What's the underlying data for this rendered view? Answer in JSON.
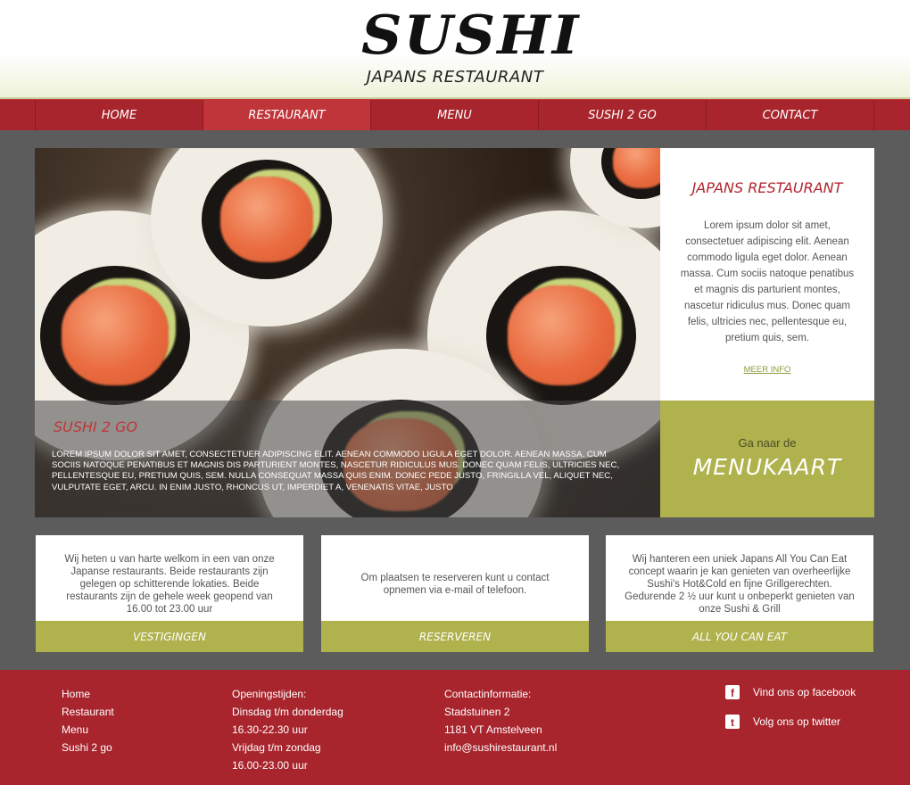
{
  "header": {
    "logo_title": "SUSHI",
    "logo_subtitle": "JAPANS RESTAURANT"
  },
  "nav": {
    "items": [
      {
        "label": "HOME"
      },
      {
        "label": "RESTAURANT",
        "active": true
      },
      {
        "label": "MENU"
      },
      {
        "label": "SUSHI 2 GO"
      },
      {
        "label": "CONTACT"
      }
    ]
  },
  "hero": {
    "caption_title": "SUSHI 2 GO",
    "caption_text": "Lorem ipsum dolor sit amet, consectetuer adipiscing elit. Aenean commodo ligula eget dolor. Aenean massa. Cum sociis natoque penatibus et magnis dis parturient montes, nascetur ridiculus mus. Donec quam felis, ultricies nec, pellentesque eu, pretium quis, sem. Nulla consequat massa quis enim. Donec pede justo, fringilla vel, aliquet nec, vulputate eget, arcu. In enim justo, rhoncus ut, imperdiet a, venenatis vitae, justo"
  },
  "info": {
    "title": "JAPANS RESTAURANT",
    "text": "Lorem ipsum dolor sit amet, consectetuer adipiscing elit. Aenean commodo ligula eget dolor. Aenean massa. Cum sociis natoque penatibus et magnis dis parturient montes, nascetur ridiculus mus. Donec quam felis, ultricies nec, pellentesque eu, pretium quis, sem.",
    "link": "MEER INFO"
  },
  "menu_cta": {
    "sub": "Ga naar de",
    "main": "MENUKAART"
  },
  "cards": [
    {
      "text": "Wij heten u van harte welkom in een van onze Japanse restaurants. Beide restaurants zijn gelegen op schitterende lokaties. Beide restaurants zijn de gehele week geopend van 16.00 tot 23.00 uur",
      "button": "VESTIGINGEN"
    },
    {
      "text": "Om plaatsen te reserveren kunt u contact opnemen via e-mail of telefoon.",
      "button": "RESERVEREN"
    },
    {
      "text": "Wij hanteren een uniek Japans All You Can Eat concept waarin je kan genieten van overheerlijke Sushi's Hot&Cold en fijne Grillgerechten. Gedurende 2 ½ uur kunt u onbeperkt genieten van onze Sushi & Grill",
      "button": "ALL YOU CAN EAT"
    }
  ],
  "footer": {
    "links": [
      "Home",
      "Restaurant",
      "Menu",
      "Sushi 2 go"
    ],
    "hours": [
      "Openingstijden:",
      "Dinsdag t/m donderdag",
      "16.30-22.30 uur",
      "Vrijdag t/m zondag",
      "16.00-23.00 uur"
    ],
    "contact": [
      "Contactinformatie:",
      "Stadstuinen 2",
      "1181 VT Amstelveen",
      "info@sushirestaurant.nl"
    ],
    "facebook": "Vind ons op facebook",
    "twitter": "Volg ons op twitter"
  },
  "colors": {
    "brand_red": "#a8252d",
    "accent_olive": "#b0b24e",
    "background": "#5c5c5c"
  }
}
